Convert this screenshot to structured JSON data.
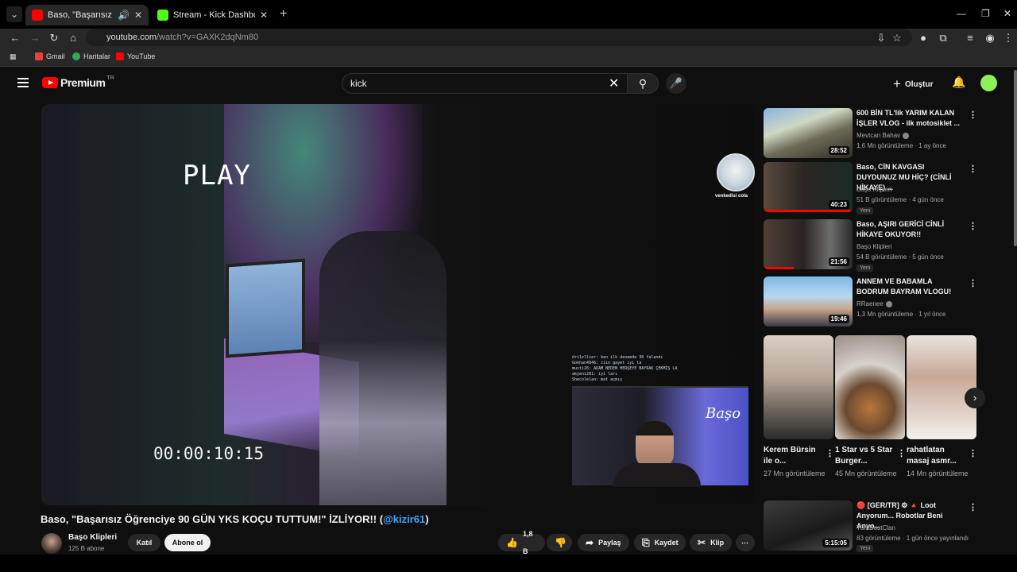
{
  "browser": {
    "tabs": [
      {
        "title": "Baso, \"Başarısız Öğrenciye S",
        "active": true
      },
      {
        "title": "Stream - Kick Dashboard",
        "active": false
      }
    ],
    "url_host": "youtube.com",
    "url_path": "/watch?v=GAXK2dqNm80",
    "bookmarks": [
      "Gmail",
      "Haritalar",
      "YouTube"
    ]
  },
  "header": {
    "logo": "Premium",
    "logo_region": "TR",
    "search_value": "kick",
    "create_label": "Oluştur"
  },
  "player": {
    "overlay_text": "PLAY",
    "timecode": "00:00:10:15",
    "cat_label": "venkedisi cola",
    "cam_label": "Başo",
    "chat_lines": [
      "dri1zllier: ben ilk denemde 30 falandı",
      "Gokhan4846: ciin gayet iyi la",
      "musti26: ADAM NEDEN HERŞEYE BAYRAK ÇEKMİŞ LA",
      "akyeni281: iyi ları",
      "Shecolelan: mat açmış"
    ]
  },
  "video": {
    "title_main": "Baso, \"Başarısız Öğrenciye 90 GÜN YKS KOÇU TUTTUM!\" İZLİYOR!! (",
    "title_link": "@kizir61",
    "title_end": ")",
    "channel": "Başo Klipleri",
    "subscribers": "125 B abone",
    "join_label": "Katıl",
    "subscribe_label": "Abone ol",
    "likes": "1,8 B",
    "share_label": "Paylaş",
    "save_label": "Kaydet",
    "clip_label": "Klip"
  },
  "sidebar": [
    {
      "title": "600 BİN TL'lik YARIM KALAN İŞLER VLOG - ilk motosiklet ...",
      "channel": "Mevtcan Bahav",
      "meta": "1,6 Mn görüntüleme · 1 ay önce",
      "duration": "28:52",
      "badge": ""
    },
    {
      "title": "Baso, CİN KAVGASI DUYDUNUZ MU HİÇ? (CİNLİ HİKAYE) ...",
      "channel": "Başo Klipleri",
      "meta": "51 B görüntüleme · 4 gün önce",
      "duration": "40:23",
      "badge": "Yeni"
    },
    {
      "title": "Baso, AŞIRI GERİCİ CİNLİ HİKAYE OKUYOR!!",
      "channel": "Başo Klipleri",
      "meta": "54 B görüntüleme · 5 gün önce",
      "duration": "21:56",
      "badge": "Yeni"
    },
    {
      "title": "ANNEM VE BABAMLA BODRUM BAYRAM VLOGU!",
      "channel": "RRaenee",
      "meta": "1,3 Mn görüntüleme · 1 yıl önce",
      "duration": "19:46",
      "badge": ""
    }
  ],
  "shorts": [
    {
      "title": "Kerem Bürsin ile o...",
      "views": "27 Mn görüntüleme"
    },
    {
      "title": "1 Star vs 5 Star Burger...",
      "views": "45 Mn görüntüleme"
    },
    {
      "title": "rahatlatan masaj asmr...",
      "views": "14 Mn görüntüleme"
    }
  ],
  "sidebar_last": {
    "title": "🔴 [GER/TR] ⚙ 🔺 Loot Anyorum... Robotlar Beni Anyo...",
    "channel": "TürkDostClan",
    "meta": "83 görüntüleme · 1 gün önce yayınlandı",
    "duration": "5:15:05",
    "badge": "Yeni"
  },
  "colors": {
    "accent": "#ff0000",
    "link": "#3ea6ff",
    "bg": "#0f0f0f"
  }
}
